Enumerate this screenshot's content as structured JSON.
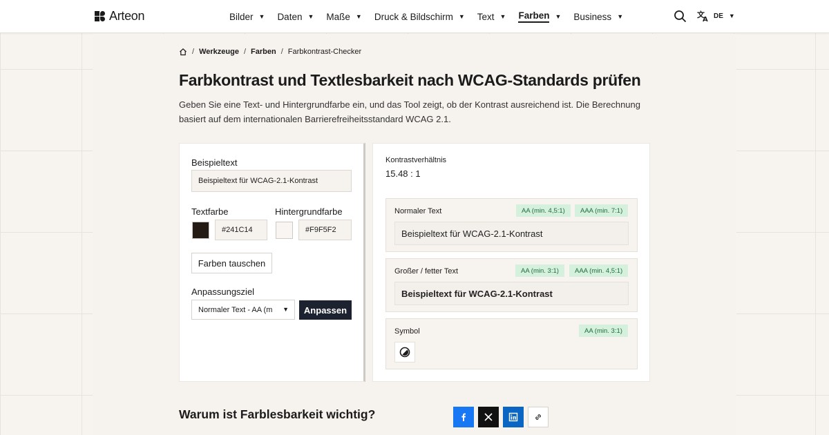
{
  "header": {
    "logo_text": "Arteon",
    "nav": [
      {
        "label": "Bilder"
      },
      {
        "label": "Daten"
      },
      {
        "label": "Maße"
      },
      {
        "label": "Druck & Bildschirm"
      },
      {
        "label": "Text"
      },
      {
        "label": "Farben",
        "active": true
      },
      {
        "label": "Business"
      }
    ],
    "search_icon": "search-icon",
    "language": {
      "icon": "translate-icon",
      "code": "DE"
    }
  },
  "breadcrumb": {
    "home_icon": "home-icon",
    "items": [
      "Werkzeuge",
      "Farben",
      "Farbkontrast-Checker"
    ]
  },
  "page": {
    "title": "Farbkontrast und Textlesbarkeit nach WCAG-Standards prüfen",
    "intro": "Geben Sie eine Text- und Hintergrundfarbe ein, und das Tool zeigt, ob der Kontrast ausreichend ist. Die Berechnung basiert auf dem internationalen Barrierefreiheitsstandard WCAG 2.1."
  },
  "form": {
    "sample_label": "Beispieltext",
    "sample_value": "Beispieltext für WCAG-2.1-Kontrast",
    "text_color_label": "Textfarbe",
    "text_color_value": "#241C14",
    "bg_color_label": "Hintergrundfarbe",
    "bg_color_value": "#F9F5F2",
    "swap_label": "Farben tauschen",
    "target_label": "Anpassungsziel",
    "target_value": "Normaler Text - AA (m",
    "adjust_label": "Anpassen"
  },
  "results": {
    "ratio_label": "Kontrastverhältnis",
    "ratio_value": "15.48 : 1",
    "normal": {
      "title": "Normaler Text",
      "badges": [
        "AA (min. 4,5:1)",
        "AAA (min. 7:1)"
      ],
      "preview": "Beispieltext für WCAG-2.1-Kontrast"
    },
    "large": {
      "title": "Großer / fetter Text",
      "badges": [
        "AA (min. 3:1)",
        "AAA (min. 4,5:1)"
      ],
      "preview": "Beispieltext für WCAG-2.1-Kontrast"
    },
    "symbol": {
      "title": "Symbol",
      "badges": [
        "AA (min. 3:1)"
      ],
      "icon": "contrast-icon"
    }
  },
  "footer_section": {
    "title": "Warum ist Farblesbarkeit wichtig?",
    "share": [
      {
        "name": "facebook-icon",
        "color": "#1877f2"
      },
      {
        "name": "x-icon",
        "color": "#111111"
      },
      {
        "name": "linkedin-icon",
        "color": "#0a66c2"
      },
      {
        "name": "link-icon",
        "color": "#ffffff"
      }
    ]
  },
  "colors": {
    "text_swatch": "#241C14",
    "bg_swatch": "#F9F5F2",
    "badge_bg": "#d5f1de",
    "badge_text": "#1e6b3a",
    "primary_button": "#1c2230"
  }
}
